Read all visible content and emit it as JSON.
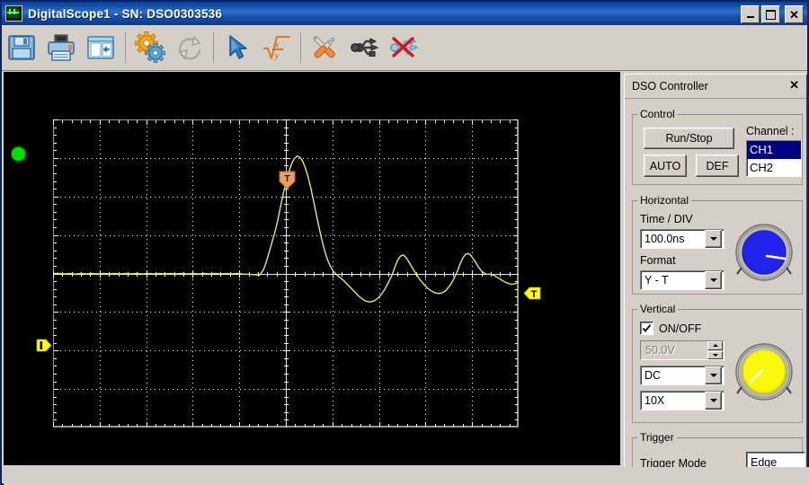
{
  "window": {
    "title": "DigitalScope1 - SN: DSO0303536",
    "app_icon": "scope-icon",
    "minimize_label": "_",
    "maximize_label": "□",
    "close_label": "✕"
  },
  "toolbar": {
    "buttons": [
      {
        "name": "save-button",
        "icon": "floppy-disk-icon",
        "tooltip": "Save"
      },
      {
        "name": "print-button",
        "icon": "printer-icon",
        "tooltip": "Print"
      },
      {
        "name": "panel-toggle-button",
        "icon": "side-panel-icon",
        "tooltip": "Show/Hide Panel"
      },
      {
        "name": "settings-button",
        "icon": "gears-icon",
        "tooltip": "Settings"
      },
      {
        "name": "refresh-button",
        "icon": "refresh-circular-icon",
        "tooltip": "Refresh"
      },
      {
        "name": "cursor-button",
        "icon": "cursor-arrow-icon",
        "tooltip": "Cursor"
      },
      {
        "name": "math-button",
        "icon": "sqrt-x-over-y-icon",
        "tooltip": "Math"
      },
      {
        "name": "tools-button",
        "icon": "wrench-screwdriver-icon",
        "tooltip": "Tools"
      },
      {
        "name": "usb-connect-button",
        "icon": "usb-icon",
        "tooltip": "Connect USB"
      },
      {
        "name": "usb-disconnect-button",
        "icon": "usb-disconnected-icon",
        "tooltip": "Disconnect USB"
      }
    ]
  },
  "scope": {
    "run_indicator": "run-led-green",
    "run_indicator_color": "#00e000",
    "background": "#000000",
    "grid_color": "#ffffff",
    "trace_color": "#e8e860",
    "markers": {
      "trigger_position_label": "T",
      "trigger_level_label": "T",
      "channel_ground_label": "",
      "trigger_position_color": "#e8a060",
      "trigger_level_color": "#ffff00",
      "channel_ground_color": "#ffff00"
    }
  },
  "chart_data": {
    "type": "line",
    "title": "",
    "xlabel": "",
    "ylabel": "",
    "grid": true,
    "divisions_x": 10,
    "divisions_y": 8,
    "time_per_div": "100.0ns",
    "volts_per_div": "50.0V",
    "series": [
      {
        "name": "CH1",
        "color": "#e8e860",
        "points": [
          [
            0.0,
            0.0
          ],
          [
            0.012,
            0.0
          ],
          [
            0.024,
            -0.01
          ],
          [
            0.036,
            0.0
          ],
          [
            0.048,
            -0.015
          ],
          [
            0.06,
            0.0
          ],
          [
            0.072,
            -0.01
          ],
          [
            0.084,
            0.0
          ],
          [
            0.096,
            -0.012
          ],
          [
            0.108,
            0.0
          ],
          [
            0.12,
            -0.01
          ],
          [
            0.132,
            0.0
          ],
          [
            0.144,
            -0.012
          ],
          [
            0.156,
            0.0
          ],
          [
            0.168,
            -0.01
          ],
          [
            0.18,
            0.0
          ],
          [
            0.192,
            -0.014
          ],
          [
            0.204,
            0.0
          ],
          [
            0.216,
            -0.01
          ],
          [
            0.228,
            0.0
          ],
          [
            0.24,
            -0.012
          ],
          [
            0.252,
            0.0
          ],
          [
            0.264,
            -0.01
          ],
          [
            0.276,
            0.0
          ],
          [
            0.288,
            -0.012
          ],
          [
            0.3,
            0.0
          ],
          [
            0.312,
            -0.01
          ],
          [
            0.324,
            0.0
          ],
          [
            0.336,
            -0.012
          ],
          [
            0.348,
            0.0
          ],
          [
            0.36,
            -0.01
          ],
          [
            0.372,
            0.0
          ],
          [
            0.384,
            -0.012
          ],
          [
            0.396,
            0.0
          ],
          [
            0.408,
            -0.015
          ],
          [
            0.42,
            -0.02
          ],
          [
            0.432,
            -0.03
          ],
          [
            0.444,
            -0.04
          ],
          [
            0.452,
            0.1
          ],
          [
            0.458,
            0.3
          ],
          [
            0.464,
            0.55
          ],
          [
            0.47,
            0.8
          ],
          [
            0.476,
            1.05
          ],
          [
            0.482,
            1.35
          ],
          [
            0.488,
            1.7
          ],
          [
            0.494,
            2.05
          ],
          [
            0.5,
            2.35
          ],
          [
            0.506,
            2.62
          ],
          [
            0.512,
            2.84
          ],
          [
            0.518,
            2.98
          ],
          [
            0.524,
            3.05
          ],
          [
            0.53,
            3.02
          ],
          [
            0.536,
            2.92
          ],
          [
            0.542,
            2.74
          ],
          [
            0.548,
            2.5
          ],
          [
            0.554,
            2.2
          ],
          [
            0.56,
            1.86
          ],
          [
            0.566,
            1.5
          ],
          [
            0.572,
            1.16
          ],
          [
            0.578,
            0.84
          ],
          [
            0.584,
            0.56
          ],
          [
            0.59,
            0.34
          ],
          [
            0.596,
            0.18
          ],
          [
            0.602,
            0.06
          ],
          [
            0.608,
            -0.02
          ],
          [
            0.616,
            -0.1
          ],
          [
            0.624,
            -0.18
          ],
          [
            0.632,
            -0.28
          ],
          [
            0.64,
            -0.38
          ],
          [
            0.648,
            -0.48
          ],
          [
            0.656,
            -0.58
          ],
          [
            0.664,
            -0.66
          ],
          [
            0.672,
            -0.72
          ],
          [
            0.68,
            -0.74
          ],
          [
            0.688,
            -0.72
          ],
          [
            0.696,
            -0.66
          ],
          [
            0.704,
            -0.56
          ],
          [
            0.712,
            -0.42
          ],
          [
            0.72,
            -0.24
          ],
          [
            0.728,
            -0.04
          ],
          [
            0.734,
            0.16
          ],
          [
            0.74,
            0.34
          ],
          [
            0.746,
            0.45
          ],
          [
            0.752,
            0.48
          ],
          [
            0.758,
            0.42
          ],
          [
            0.764,
            0.3
          ],
          [
            0.772,
            0.14
          ],
          [
            0.78,
            -0.02
          ],
          [
            0.788,
            -0.16
          ],
          [
            0.796,
            -0.28
          ],
          [
            0.804,
            -0.38
          ],
          [
            0.812,
            -0.45
          ],
          [
            0.82,
            -0.5
          ],
          [
            0.828,
            -0.52
          ],
          [
            0.836,
            -0.5
          ],
          [
            0.844,
            -0.44
          ],
          [
            0.852,
            -0.32
          ],
          [
            0.86,
            -0.16
          ],
          [
            0.868,
            0.04
          ],
          [
            0.874,
            0.24
          ],
          [
            0.88,
            0.4
          ],
          [
            0.886,
            0.5
          ],
          [
            0.892,
            0.52
          ],
          [
            0.898,
            0.46
          ],
          [
            0.906,
            0.32
          ],
          [
            0.914,
            0.16
          ],
          [
            0.922,
            0.04
          ],
          [
            0.93,
            -0.02
          ],
          [
            0.938,
            -0.02
          ],
          [
            0.946,
            -0.04
          ],
          [
            0.954,
            -0.1
          ],
          [
            0.962,
            -0.16
          ],
          [
            0.97,
            -0.22
          ],
          [
            0.978,
            -0.26
          ],
          [
            0.986,
            -0.28
          ],
          [
            0.994,
            -0.26
          ],
          [
            1.0,
            -0.22
          ]
        ]
      }
    ],
    "xlim": [
      0,
      1
    ],
    "ylim": [
      -4,
      4
    ]
  },
  "dock": {
    "title": "DSO Controller",
    "close_label": "✕",
    "control": {
      "legend": "Control",
      "run_stop_label": "Run/Stop",
      "auto_label": "AUTO",
      "def_label": "DEF",
      "channel_label": "Channel :",
      "channels": [
        {
          "label": "CH1",
          "selected": true
        },
        {
          "label": "CH2",
          "selected": false
        }
      ]
    },
    "horizontal": {
      "legend": "Horizontal",
      "time_div_label": "Time / DIV",
      "time_div_value": "100.0ns",
      "format_label": "Format",
      "format_value": "Y - T",
      "knob_name": "horizontal-position-knob",
      "knob_color": "#2020e8"
    },
    "vertical": {
      "legend": "Vertical",
      "onoff_label": "ON/OFF",
      "onoff_checked": true,
      "volts_div_value": "50.0V",
      "coupling_value": "DC",
      "probe_value": "10X",
      "knob_name": "vertical-position-knob",
      "knob_color": "#f0f000"
    },
    "trigger": {
      "legend": "Trigger",
      "mode_label": "Trigger Mode",
      "mode_value": "Edge"
    }
  }
}
